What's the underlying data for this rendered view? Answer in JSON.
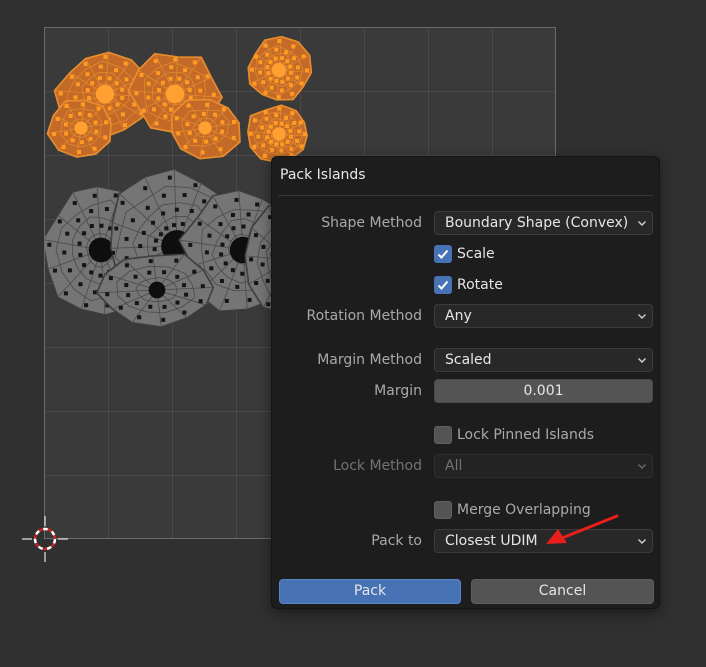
{
  "dialog": {
    "title": "Pack Islands",
    "shape_method": {
      "label": "Shape Method",
      "value": "Boundary Shape (Convex)"
    },
    "scale": {
      "label": "Scale",
      "checked": true
    },
    "rotate": {
      "label": "Rotate",
      "checked": true
    },
    "rotation_method": {
      "label": "Rotation Method",
      "value": "Any"
    },
    "margin_method": {
      "label": "Margin Method",
      "value": "Scaled"
    },
    "margin": {
      "label": "Margin",
      "value": "0.001"
    },
    "lock_pinned_islands": {
      "label": "Lock Pinned Islands",
      "checked": false
    },
    "lock_method": {
      "label": "Lock Method",
      "value": "All",
      "enabled": false
    },
    "merge_overlapping": {
      "label": "Merge Overlapping",
      "checked": false
    },
    "pack_to": {
      "label": "Pack to",
      "value": "Closest UDIM"
    },
    "buttons": {
      "pack": "Pack",
      "cancel": "Cancel"
    }
  },
  "colors": {
    "selected_island": "#c46a28",
    "unselected_island": "#757575",
    "accent": "#4772b3",
    "annotation_arrow": "#e8201c"
  },
  "icons": [
    "chevron-down-icon",
    "checkmark-icon",
    "2d-cursor-icon"
  ]
}
